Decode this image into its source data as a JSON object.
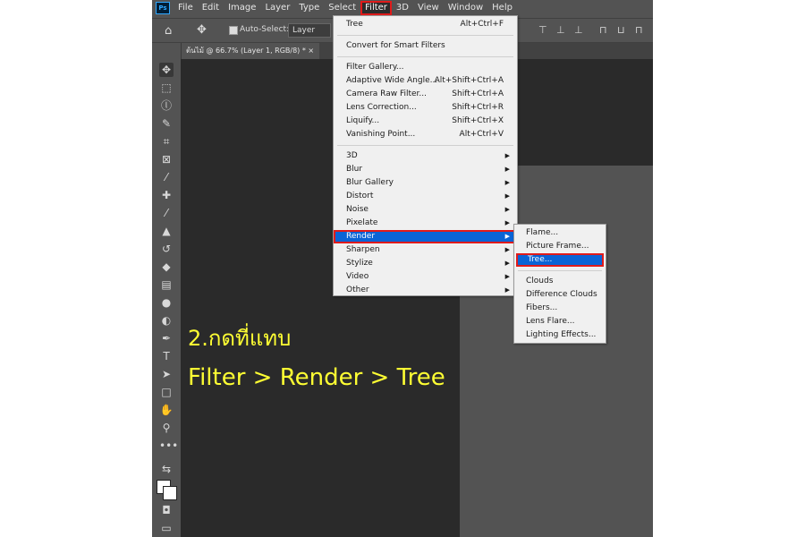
{
  "menubar": {
    "logo": "Ps",
    "items": [
      "File",
      "Edit",
      "Image",
      "Layer",
      "Type",
      "Select",
      "Filter",
      "3D",
      "View",
      "Window",
      "Help"
    ],
    "active_index": 6
  },
  "options_bar": {
    "auto_select_label": "Auto-Select:",
    "layer_dropdown_value": "Layer"
  },
  "document_tab": {
    "title": "ต้นไม้ @ 66.7% (Layer 1, RGB/8) *",
    "close": "×"
  },
  "filter_menu": {
    "last_filter": {
      "label": "Tree",
      "shortcut": "Alt+Ctrl+F"
    },
    "convert": "Convert for Smart Filters",
    "group1": [
      {
        "label": "Filter Gallery...",
        "shortcut": ""
      },
      {
        "label": "Adaptive Wide Angle...",
        "shortcut": "Alt+Shift+Ctrl+A"
      },
      {
        "label": "Camera Raw Filter...",
        "shortcut": "Shift+Ctrl+A"
      },
      {
        "label": "Lens Correction...",
        "shortcut": "Shift+Ctrl+R"
      },
      {
        "label": "Liquify...",
        "shortcut": "Shift+Ctrl+X"
      },
      {
        "label": "Vanishing Point...",
        "shortcut": "Alt+Ctrl+V"
      }
    ],
    "submenus": [
      "3D",
      "Blur",
      "Blur Gallery",
      "Distort",
      "Noise",
      "Pixelate",
      "Render",
      "Sharpen",
      "Stylize",
      "Video",
      "Other"
    ],
    "highlighted_submenu": "Render"
  },
  "render_submenu": {
    "group1": [
      "Flame...",
      "Picture Frame...",
      "Tree..."
    ],
    "highlighted": "Tree...",
    "group2": [
      "Clouds",
      "Difference Clouds",
      "Fibers...",
      "Lens Flare...",
      "Lighting Effects..."
    ]
  },
  "instruction": {
    "line1": "2.กดที่แทบ",
    "line2": "Filter > Render > Tree",
    "color": "#ffff33"
  },
  "colors": {
    "highlight": "#0a64d6",
    "callout_border": "#e01b1b"
  }
}
